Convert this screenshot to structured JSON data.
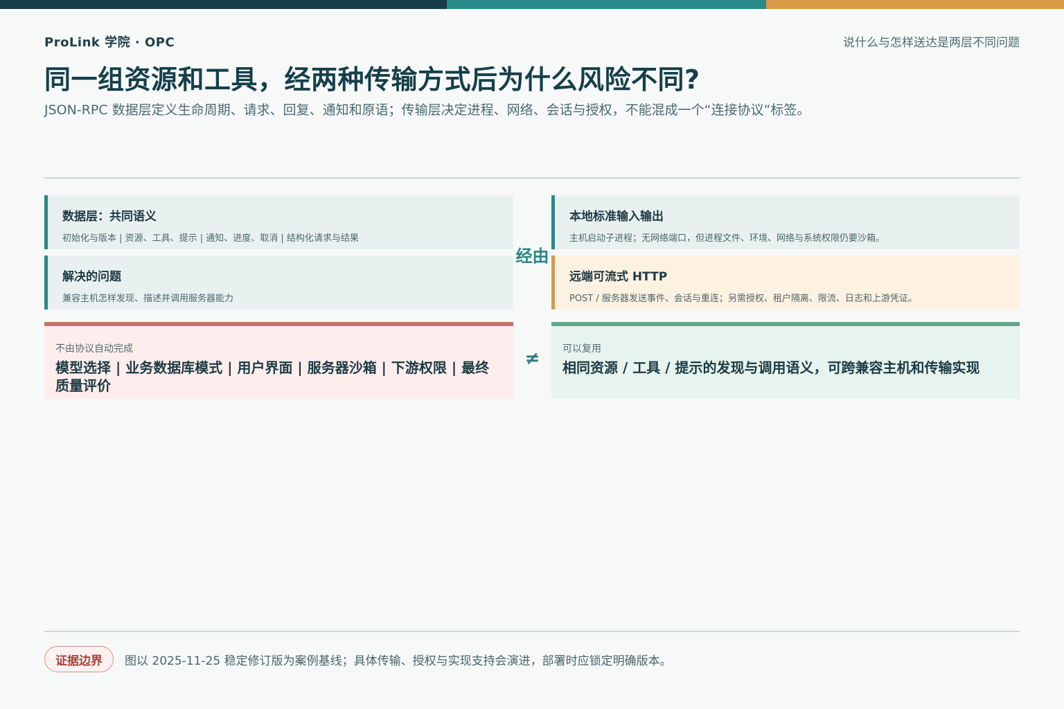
{
  "header": {
    "brand": "ProLink 学院 · OPC",
    "top_note": "说什么与怎样送达是两层不同问题",
    "title": "同一组资源和工具，经两种传输方式后为什么风险不同?",
    "subtitle": "JSON-RPC 数据层定义生命周期、请求、回复、通知和原语；传输层决定进程、网络、会话与授权，不能混成一个“连接协议”标签。"
  },
  "left": {
    "data_layer": {
      "title": "数据层：共同语义",
      "desc": "初始化与版本 | 资源、工具、提示 | 通知、进度、取消 | 结构化请求与结果"
    },
    "problem": {
      "title": "解决的问题",
      "desc": "兼容主机怎样发现、描述并调用服务器能力"
    }
  },
  "via_label": "经由",
  "right": {
    "stdio": {
      "title": "本地标准输入输出",
      "desc": "主机启动子进程；无网络端口，但进程文件、环境、网络与系统权限仍要沙箱。"
    },
    "http": {
      "title": "远端可流式 HTTP",
      "desc": "POST / 服务器发送事件、会话与重连；另需授权、租户隔离、限流、日志和上游凭证。"
    }
  },
  "not_auto": {
    "label": "不由协议自动完成",
    "text": "模型选择 | 业务数据库模式 | 用户界面 | 服务器沙箱 | 下游权限 | 最终质量评价"
  },
  "neq_symbol": "≠",
  "reusable": {
    "label": "可以复用",
    "text": "相同资源 / 工具 / 提示的发现与调用语义，可跨兼容主机和传输实现"
  },
  "footer": {
    "badge": "证据边界",
    "text": "图以 2025-11-25 稳定修订版为案例基线；具体传输、授权与实现支持会演进，部署时应锁定明确版本。"
  },
  "colors": {
    "teal": "#2b8886",
    "navy": "#173b49",
    "orange": "#d79a46",
    "red": "#c9736a",
    "green": "#65a68f"
  }
}
